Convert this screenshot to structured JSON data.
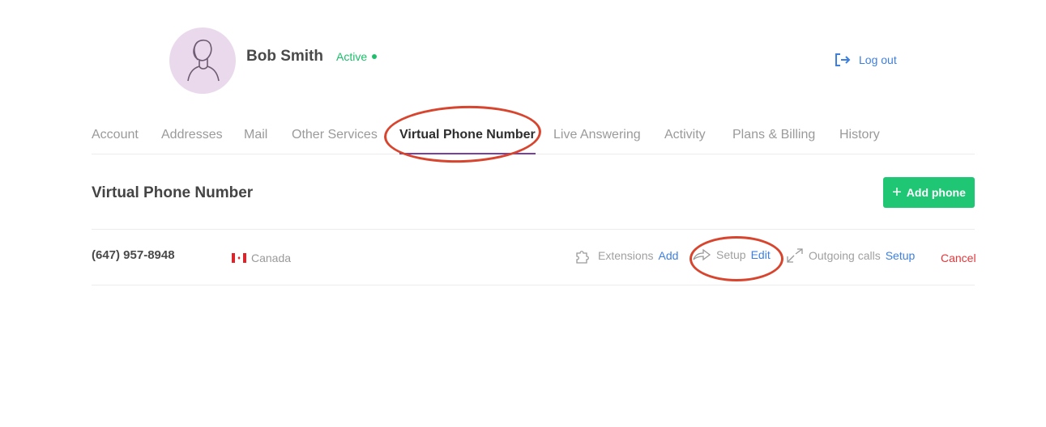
{
  "user": {
    "name": "Bob Smith",
    "status": "Active",
    "status_color": "#1cc06a"
  },
  "header": {
    "logout_label": "Log out",
    "logout_icon": "logout-icon"
  },
  "tabs": [
    {
      "label": "Account"
    },
    {
      "label": "Addresses"
    },
    {
      "label": "Mail"
    },
    {
      "label": "Other Services"
    },
    {
      "label": "Virtual Phone Number",
      "active": true
    },
    {
      "label": "Live Answering"
    },
    {
      "label": "Activity"
    },
    {
      "label": "Plans & Billing"
    },
    {
      "label": "History"
    }
  ],
  "section": {
    "title": "Virtual Phone Number",
    "add_button_label": "Add phone"
  },
  "phones": [
    {
      "number": "(647) 957-8948",
      "country": "Canada",
      "extensions_label": "Extensions",
      "extensions_action": "Add",
      "forwarding_label": "Setup",
      "forwarding_action": "Edit",
      "outgoing_label": "Outgoing calls",
      "outgoing_action": "Setup",
      "cancel_label": "Cancel"
    }
  ],
  "colors": {
    "accent_green": "#1fc774",
    "link_blue": "#3d7fe0",
    "danger_red": "#e0373a",
    "active_tab_underline": "#7b3fa0",
    "annotation_red": "#d8452f"
  }
}
